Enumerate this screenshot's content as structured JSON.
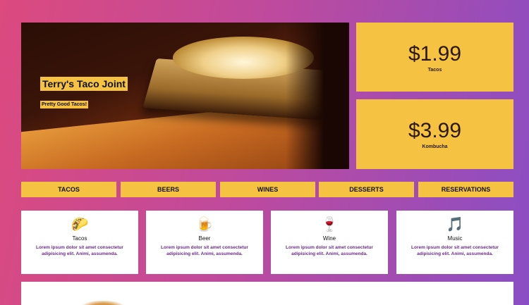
{
  "hero": {
    "title": "Terry's Taco Joint",
    "tagline": "Pretty Good Tacos!"
  },
  "prices": [
    {
      "amount": "$1.99",
      "label": "Tacos"
    },
    {
      "amount": "$3.99",
      "label": "Kombucha"
    }
  ],
  "nav": [
    "TACOS",
    "BEERS",
    "WINES",
    "DESSERTS",
    "RESERVATIONS"
  ],
  "cards": [
    {
      "icon": "🌮",
      "icon_name": "taco-icon",
      "title": "Tacos",
      "body": "Lorem ipsum dolor sit amet consectetur adipisicing elit. Animi, assumenda."
    },
    {
      "icon": "🍺",
      "icon_name": "beer-mug-icon",
      "title": "Beer",
      "body": "Lorem ipsum dolor sit amet consectetur adipisicing elit. Animi, assumenda."
    },
    {
      "icon": "🍷",
      "icon_name": "wine-glass-icon",
      "title": "Wine",
      "body": "Lorem ipsum dolor sit amet consectetur adipisicing elit. Animi, assumenda."
    },
    {
      "icon": "🎵",
      "icon_name": "music-note-icon",
      "title": "Music",
      "body": "Lorem ipsum dolor sit amet consectetur adipisicing elit. Animi, assumenda."
    }
  ],
  "colors": {
    "accent": "#f5c242",
    "gradient_start": "#dc4a7e",
    "gradient_end": "#8a4ec4",
    "card_text": "#6c2a8a"
  }
}
